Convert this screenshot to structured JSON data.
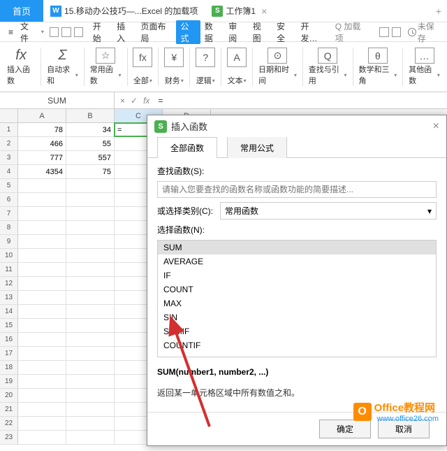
{
  "tabs": {
    "home": "首页",
    "file_icon": "W",
    "file_name": "15.移动办公技巧—...Excel 的加载项",
    "sheet_icon": "S",
    "sheet_name": "工作簿1"
  },
  "menubar": {
    "file_menu": "文件",
    "items": [
      "开始",
      "插入",
      "页面布局",
      "公式",
      "数据",
      "审阅",
      "视图",
      "安全",
      "开发…"
    ],
    "active_index": 3,
    "addon_label": "加载项",
    "unsaved": "未保存"
  },
  "ribbon": {
    "groups": [
      {
        "icon": "fx",
        "label": "插入函数"
      },
      {
        "icon": "Σ",
        "label": "自动求和"
      },
      {
        "icon": "☆",
        "boxed": true,
        "label": "常用函数"
      },
      {
        "icon": "fx",
        "boxed": true,
        "label": "全部"
      },
      {
        "icon": "¥",
        "boxed": true,
        "label": "财务"
      },
      {
        "icon": "?",
        "boxed": true,
        "label": "逻辑"
      },
      {
        "icon": "A",
        "boxed": true,
        "label": "文本"
      },
      {
        "icon": "⊙",
        "boxed": true,
        "label": "日期和时间"
      },
      {
        "icon": "Q",
        "boxed": true,
        "label": "查找与引用"
      },
      {
        "icon": "θ",
        "boxed": true,
        "label": "数学和三角"
      },
      {
        "icon": "…",
        "boxed": true,
        "label": "其他函数"
      }
    ]
  },
  "formula_bar": {
    "name_box": "SUM",
    "formula": "="
  },
  "columns": [
    "A",
    "B",
    "C",
    "D"
  ],
  "chart_data": {
    "type": "table",
    "columns": [
      "A",
      "B",
      "C"
    ],
    "rows": [
      {
        "A": 78,
        "B": 34,
        "C": "="
      },
      {
        "A": 466,
        "B": 55,
        "C": ""
      },
      {
        "A": 777,
        "B": 557,
        "C": ""
      },
      {
        "A": 4354,
        "B": 75,
        "C": ""
      }
    ],
    "display_rows": 23,
    "active_cell": "C1"
  },
  "dialog": {
    "title": "插入函数",
    "tabs": [
      "全部函数",
      "常用公式"
    ],
    "search_label": "查找函数(S):",
    "search_placeholder": "请输入您要查找的函数名称或函数功能的简要描述...",
    "category_label": "或选择类别(C):",
    "category_value": "常用函数",
    "list_label": "选择函数(N):",
    "functions": [
      "SUM",
      "AVERAGE",
      "IF",
      "COUNT",
      "MAX",
      "SIN",
      "SUMIF",
      "COUNTIF"
    ],
    "selected_index": 0,
    "syntax": "SUM(number1, number2, ...)",
    "description": "返回某一单元格区域中所有数值之和。",
    "ok": "确定",
    "cancel": "取消"
  },
  "watermark": {
    "logo": "O",
    "title": "Office教程网",
    "sub": "www.office26.com"
  }
}
